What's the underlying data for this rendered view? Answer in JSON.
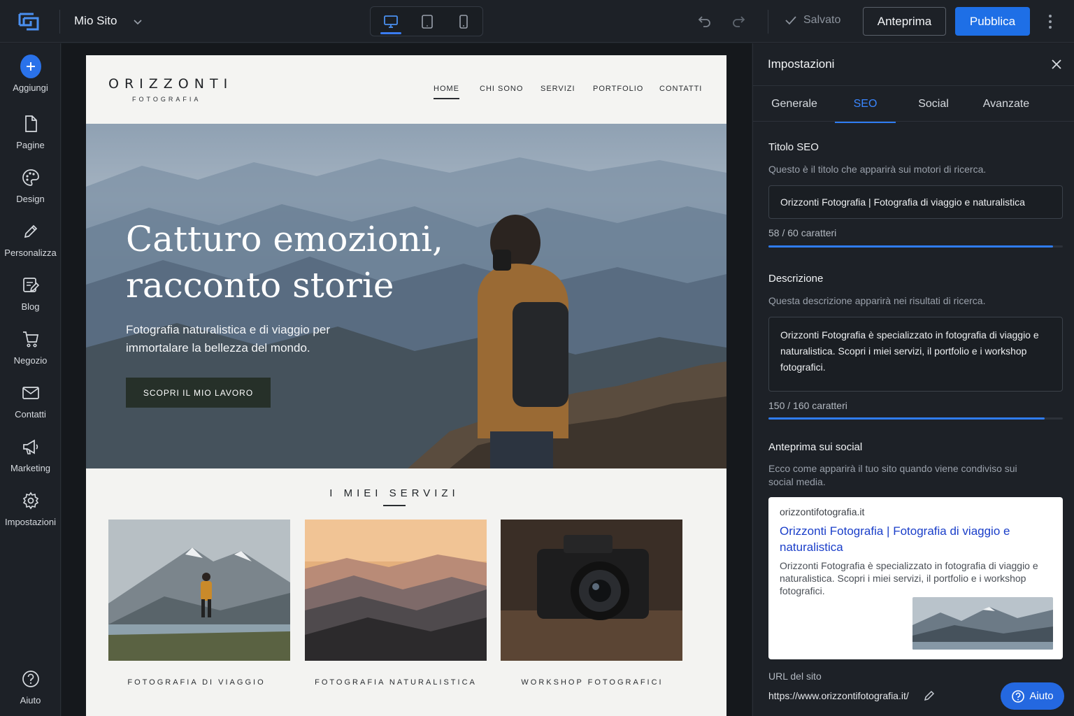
{
  "topbar": {
    "site_name": "Mio Sito",
    "saved_label": "Salvato",
    "preview_label": "Anteprima",
    "publish_label": "Pubblica"
  },
  "sidebar": {
    "items": [
      {
        "label": "Aggiungi",
        "icon": "plus-icon"
      },
      {
        "label": "Pagine",
        "icon": "page-icon"
      },
      {
        "label": "Design",
        "icon": "palette-icon"
      },
      {
        "label": "Personalizza",
        "icon": "pencil-icon"
      },
      {
        "label": "Blog",
        "icon": "blog-edit-icon"
      },
      {
        "label": "Negozio",
        "icon": "cart-icon"
      },
      {
        "label": "Contatti",
        "icon": "mail-icon"
      },
      {
        "label": "Marketing",
        "icon": "megaphone-icon"
      },
      {
        "label": "Impostazioni",
        "icon": "gear-icon"
      }
    ],
    "help_label": "Aiuto"
  },
  "site": {
    "brand": "ORIZZONTI",
    "brand_sub": "FOTOGRAFIA",
    "nav": [
      "HOME",
      "CHI SONO",
      "SERVIZI",
      "PORTFOLIO",
      "CONTATTI"
    ],
    "hero_title_line1": "Catturo emozioni,",
    "hero_title_line2": "racconto storie",
    "hero_sub": "Fotografia naturalistica e di viaggio per immortalare la bellezza del mondo.",
    "hero_cta": "SCOPRI IL MIO LAVORO",
    "services_title": "I MIEI SERVIZI",
    "services": [
      "FOTOGRAFIA DI VIAGGIO",
      "FOTOGRAFIA NATURALISTICA",
      "WORKSHOP FOTOGRAFICI"
    ]
  },
  "panel": {
    "title": "Impostazioni",
    "tabs": [
      "Generale",
      "SEO",
      "Social",
      "Avanzate"
    ],
    "active_tab": "SEO",
    "seo_title_label": "Titolo SEO",
    "seo_title_help": "Questo è il titolo che apparirà sui motori di ricerca.",
    "seo_title_value": "Orizzonti Fotografia | Fotografia di viaggio e naturalistica",
    "seo_title_counter": "58 / 60 caratteri",
    "seo_title_ratio": 0.9667,
    "desc_label": "Descrizione",
    "desc_help": "Questa descrizione apparirà nei risultati di ricerca.",
    "desc_value": "Orizzonti Fotografia è specializzato in fotografia di viaggio e naturalistica. Scopri i miei servizi, il portfolio e i workshop fotografici.",
    "desc_counter": "150 / 160 caratteri",
    "desc_ratio": 0.9375,
    "social_label": "Anteprima sui social",
    "social_help": "Ecco come apparirà il tuo sito quando viene condiviso sui social media.",
    "social_domain": "orizzontifotografia.it",
    "social_title": "Orizzonti Fotografia | Fotografia di viaggio e naturalistica",
    "social_desc": "Orizzonti Fotografia è specializzato in fotografia di viaggio e naturalistica. Scopri i miei servizi, il portfolio e i workshop fotografici.",
    "url_label": "URL del sito",
    "url_value": "https://www.orizzontifotografia.it/",
    "help_label": "Aiuto"
  },
  "colors": {
    "accent": "#1e6fe6",
    "panel_bg": "#1d2127",
    "link_blue": "#1a3ec9"
  }
}
